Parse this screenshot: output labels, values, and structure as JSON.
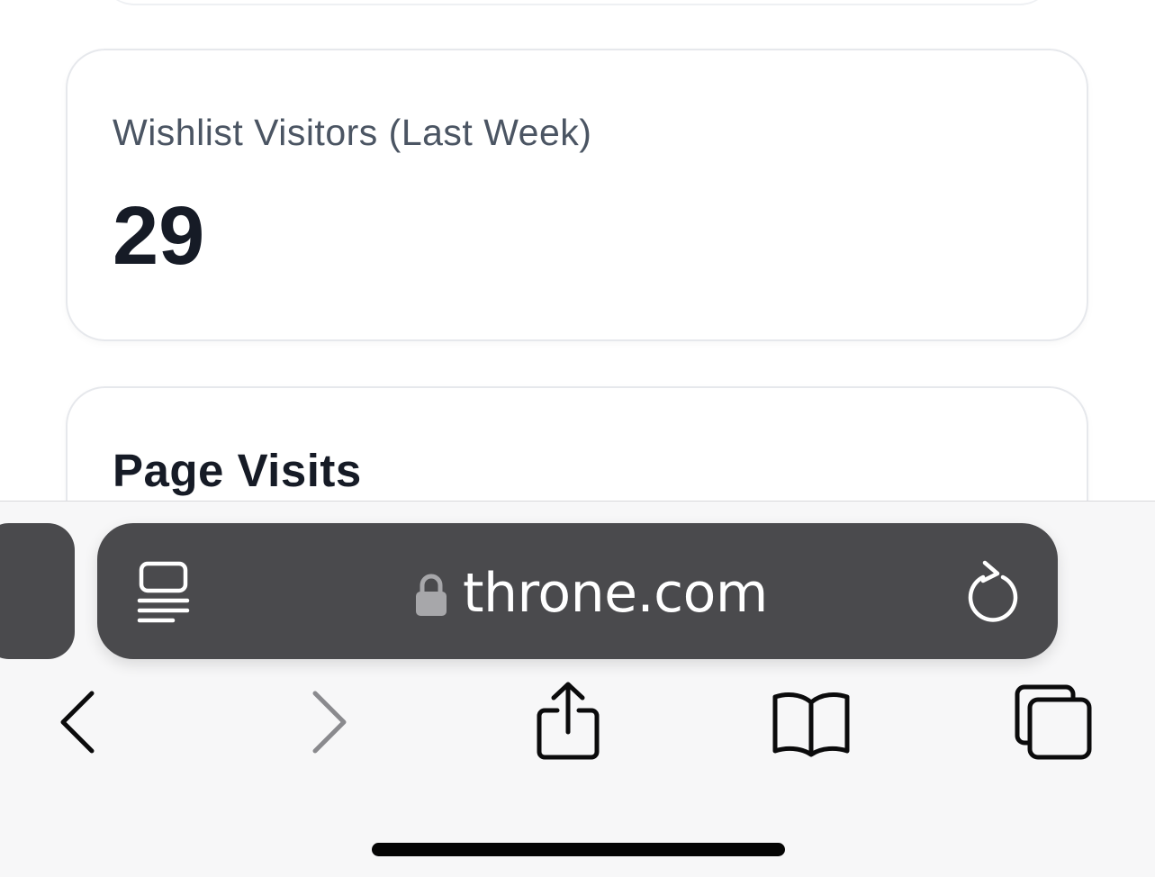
{
  "visitors_card": {
    "label": "Wishlist Visitors (Last Week)",
    "value": "29"
  },
  "visits_card": {
    "title": "Page Visits"
  },
  "browser": {
    "url": "throne.com",
    "icons": {
      "reader": "reader-mode-icon",
      "lock": "lock-icon",
      "reload": "reload-icon",
      "back": "back-chevron-icon",
      "forward": "forward-chevron-icon",
      "share": "share-icon",
      "bookmarks": "bookmarks-book-icon",
      "tabs": "tabs-overview-icon"
    },
    "colors": {
      "address_bar": "#4a4a4d",
      "toolbar_bg": "#f7f7f8"
    }
  }
}
